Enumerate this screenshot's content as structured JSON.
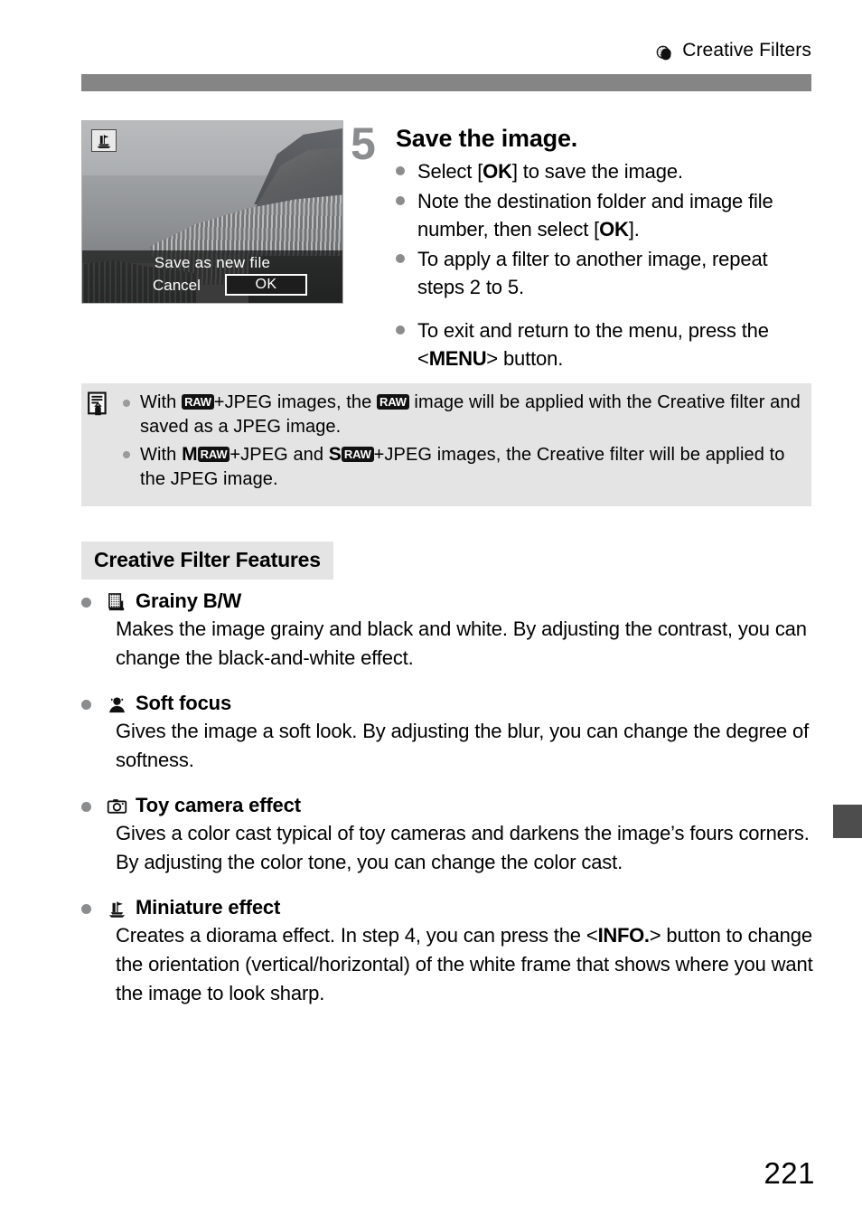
{
  "header": {
    "chapter_icon": "creative-filters-icon",
    "title": "Creative Filters"
  },
  "step": {
    "number": "5",
    "title": "Save the image.",
    "bullets": [
      {
        "id": "select-ok",
        "parts": [
          {
            "t": "text",
            "v": "Select ["
          },
          {
            "t": "bold",
            "v": "OK"
          },
          {
            "t": "text",
            "v": "] to save the image."
          }
        ]
      },
      {
        "id": "note-destination",
        "parts": [
          {
            "t": "text",
            "v": "Note the destination folder and image file number, then select ["
          },
          {
            "t": "bold",
            "v": "OK"
          },
          {
            "t": "text",
            "v": "]."
          }
        ]
      },
      {
        "id": "apply-another",
        "parts": [
          {
            "t": "text",
            "v": "To apply a filter to another image, repeat steps 2 to 5."
          }
        ]
      },
      {
        "id": "exit-menu",
        "gap": true,
        "parts": [
          {
            "t": "text",
            "v": "To exit and return to the menu, press the <"
          },
          {
            "t": "btn",
            "v": "MENU"
          },
          {
            "t": "text",
            "v": "> button."
          }
        ]
      }
    ]
  },
  "screen": {
    "icon": "miniature-effect-icon",
    "dialog_title": "Save as new file",
    "cancel_label": "Cancel",
    "ok_label": "OK"
  },
  "note": {
    "icon": "note-memo-icon",
    "items": [
      {
        "id": "raw-jpeg",
        "parts": [
          {
            "t": "text",
            "v": "With "
          },
          {
            "t": "raw",
            "v": "RAW"
          },
          {
            "t": "text",
            "v": "+JPEG images, the "
          },
          {
            "t": "raw",
            "v": "RAW"
          },
          {
            "t": "text",
            "v": " image will be applied with the Creative filter and saved as a JPEG image."
          }
        ]
      },
      {
        "id": "mraw-sraw-jpeg",
        "parts": [
          {
            "t": "text",
            "v": "With "
          },
          {
            "t": "size",
            "v": "M"
          },
          {
            "t": "raw",
            "v": "RAW"
          },
          {
            "t": "text",
            "v": "+JPEG and "
          },
          {
            "t": "size",
            "v": "S"
          },
          {
            "t": "raw",
            "v": "RAW"
          },
          {
            "t": "text",
            "v": "+JPEG images, the Creative filter will be applied to the JPEG image."
          }
        ]
      }
    ]
  },
  "section": {
    "heading": "Creative Filter Features"
  },
  "features": [
    {
      "icon": "grainy-bw-icon",
      "name": "Grainy B/W",
      "body": "Makes the image grainy and black and white. By adjusting the contrast, you can change the black-and-white effect."
    },
    {
      "icon": "soft-focus-icon",
      "name": "Soft focus",
      "body": "Gives the image a soft look. By adjusting the blur, you can change the degree of softness."
    },
    {
      "icon": "toy-camera-icon",
      "name": "Toy camera effect",
      "body": "Gives a color cast typical of toy cameras and darkens the image’s fours corners. By adjusting the color tone, you can change the color cast."
    },
    {
      "icon": "miniature-effect-icon",
      "name": "Miniature effect",
      "body_parts": [
        {
          "t": "text",
          "v": "Creates a diorama effect. In step 4, you can press the <"
        },
        {
          "t": "btn",
          "v": "INFO."
        },
        {
          "t": "text",
          "v": "> button to change the orientation (vertical/horizontal) of the white frame that shows where you want the image to look sharp."
        }
      ]
    }
  ],
  "footer": {
    "page_number": "221",
    "side_tab": "chapter-tab-marker"
  },
  "colors": {
    "header_bar": "#858585",
    "note_bg": "#e4e4e4",
    "heading_bg": "#e4e4e4",
    "bullet": "#8a8c8e",
    "side_tab": "#4d4d4d"
  }
}
